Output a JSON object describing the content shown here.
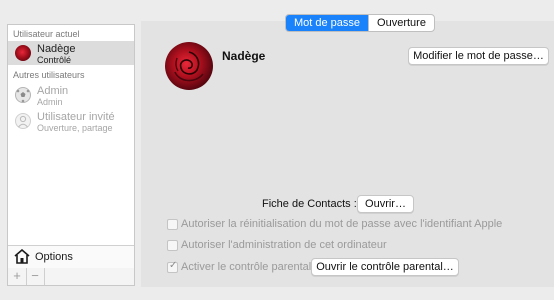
{
  "sidebar": {
    "current_header": "Utilisateur actuel",
    "others_header": "Autres utilisateurs",
    "current_user": {
      "name": "Nadège",
      "role": "Contrôlé"
    },
    "others": [
      {
        "name": "Admin",
        "role": "Admin"
      },
      {
        "name": "Utilisateur invité",
        "role": "Ouverture, partage"
      }
    ],
    "options_label": "Options",
    "add_symbol": "+",
    "remove_symbol": "−"
  },
  "tabs": [
    {
      "label": "Mot de passe",
      "active": true
    },
    {
      "label": "Ouverture",
      "active": false
    }
  ],
  "main": {
    "user_name": "Nadège",
    "change_password_button": "Modifier le mot de passe…",
    "contact_card_label": "Fiche de Contacts :",
    "open_button": "Ouvrir…",
    "checkboxes": [
      {
        "label": "Autoriser la réinitialisation du mot de passe avec l'identifiant Apple",
        "checked": false,
        "enabled": false
      },
      {
        "label": "Autoriser l'administration de cet ordinateur",
        "checked": false,
        "enabled": false
      },
      {
        "label": "Activer le contrôle parental",
        "checked": true,
        "enabled": false
      }
    ],
    "parental_controls_button": "Ouvrir le contrôle parental…"
  },
  "colors": {
    "accent": "#1a82fb",
    "avatar_red": "#b0101e"
  }
}
